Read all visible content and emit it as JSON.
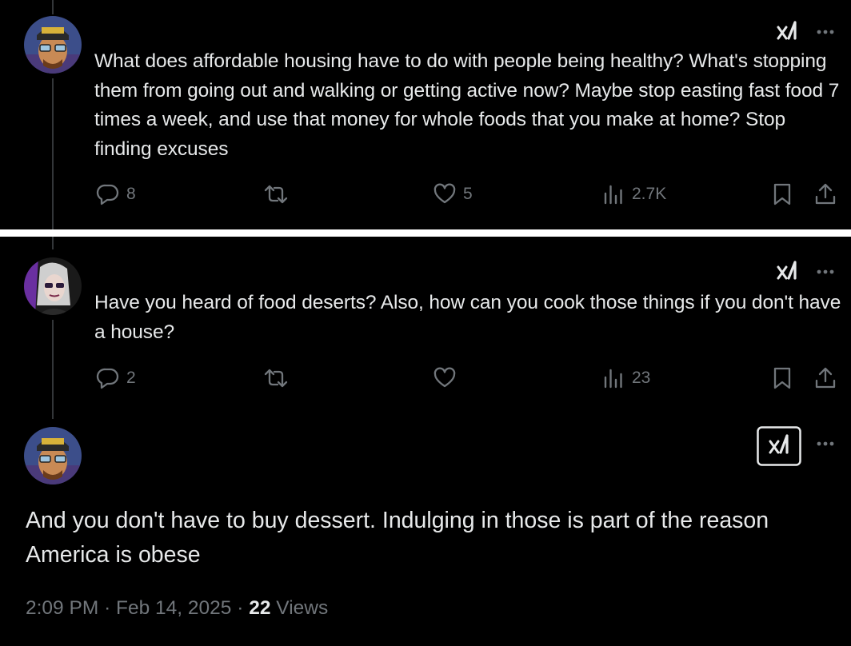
{
  "reply_1": {
    "text": "What does affordable housing have to do with people being healthy? What's stopping them from going out and walking or getting active now? Maybe stop easting fast food 7 times a week, and use that money for whole foods that you make at home? Stop finding excuses",
    "replies": "8",
    "reposts": "",
    "likes": "5",
    "views": "2.7K"
  },
  "reply_2": {
    "text": "Have you heard of food deserts? Also, how can you cook those things if you don't have a house?",
    "replies": "2",
    "reposts": "",
    "likes": "",
    "views": "23"
  },
  "focal": {
    "text": "And you don't have to buy dessert. Indulging in those is part of the reason America is obese",
    "time": "2:09 PM",
    "date": "Feb 14, 2025",
    "views_count": "22",
    "views_label": "Views"
  },
  "icons": [
    "grok-icon",
    "more-icon",
    "reply-icon",
    "repost-icon",
    "like-icon",
    "views-icon",
    "bookmark-icon",
    "share-icon"
  ],
  "colors": {
    "background": "#000000",
    "text": "#e7e9ea",
    "muted": "#71767b",
    "divider": "#ffffff"
  }
}
